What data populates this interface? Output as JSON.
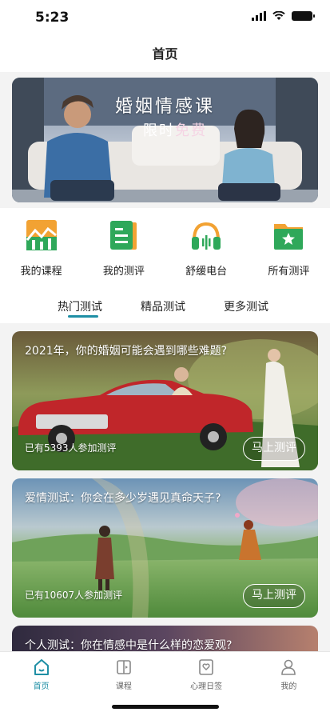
{
  "status": {
    "time": "5:23"
  },
  "nav": {
    "title": "首页"
  },
  "banner": {
    "title": "婚姻情感课",
    "subtitle_a": "限时",
    "subtitle_b": "免费"
  },
  "quick": [
    {
      "label": "我的课程",
      "icon": "bar-chart-icon"
    },
    {
      "label": "我的测评",
      "icon": "document-icon"
    },
    {
      "label": "舒缓电台",
      "icon": "headphones-icon"
    },
    {
      "label": "所有测评",
      "icon": "star-folder-icon"
    }
  ],
  "tabs": [
    {
      "label": "热门测试",
      "active": true
    },
    {
      "label": "精品测试",
      "active": false
    },
    {
      "label": "更多测试",
      "active": false
    }
  ],
  "cards": [
    {
      "title": "2021年，你的婚姻可能会遇到哪些难题?",
      "count": "已有5393人参加测评",
      "button": "马上测评"
    },
    {
      "title": "爱情测试：你会在多少岁遇见真命天子?",
      "count": "已有10607人参加测评",
      "button": "马上测评"
    },
    {
      "title": "个人测试：你在情感中是什么样的恋爱观?"
    }
  ],
  "tabbar": [
    {
      "label": "首页",
      "icon": "home-icon",
      "active": true
    },
    {
      "label": "课程",
      "icon": "book-icon",
      "active": false
    },
    {
      "label": "心理日签",
      "icon": "heart-card-icon",
      "active": false
    },
    {
      "label": "我的",
      "icon": "person-icon",
      "active": false
    }
  ],
  "colors": {
    "accent": "#1f8fa5",
    "icon_green": "#2fa85a",
    "icon_orange": "#f2a233"
  }
}
